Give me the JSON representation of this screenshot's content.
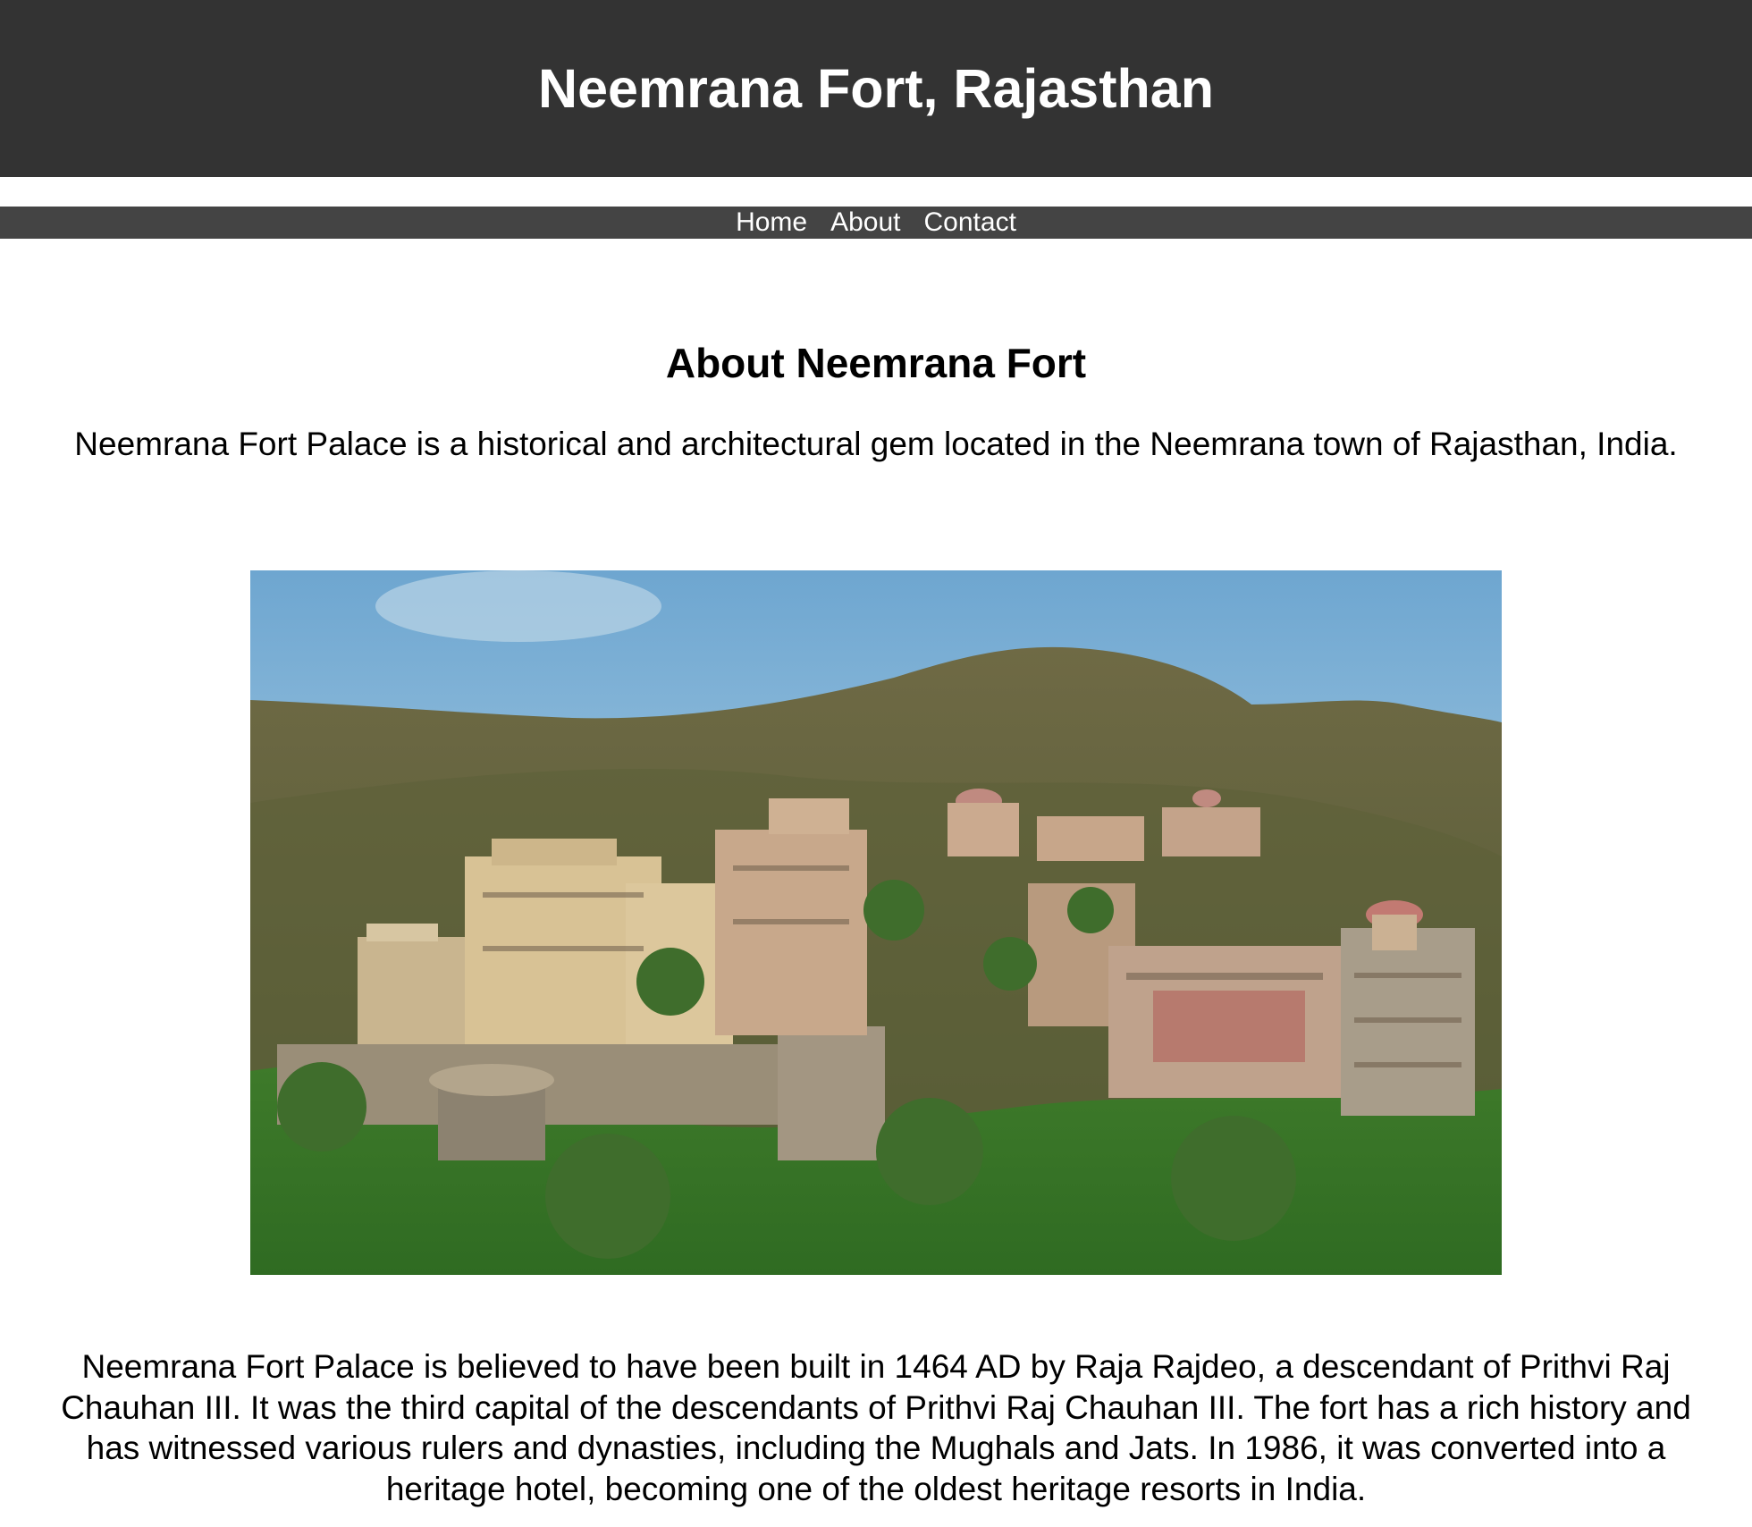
{
  "header": {
    "title": "Neemrana Fort, Rajasthan"
  },
  "nav": {
    "items": [
      {
        "label": "Home"
      },
      {
        "label": "About"
      },
      {
        "label": "Contact"
      }
    ]
  },
  "about": {
    "heading": "About Neemrana Fort",
    "intro": "Neemrana Fort Palace is a historical and architectural gem located in the Neemrana town of Rajasthan, India.",
    "history": "Neemrana Fort Palace is believed to have been built in 1464 AD by Raja Rajdeo, a descendant of Prithvi Raj Chauhan III. It was the third capital of the descendants of Prithvi Raj Chauhan III. The fort has a rich history and has witnessed various rulers and dynasties, including the Mughals and Jats. In 1986, it was converted into a heritage hotel, becoming one of the oldest heritage resorts in India."
  },
  "colors": {
    "header_bg": "#333333",
    "nav_bg": "#444444",
    "text_light": "#ffffff",
    "text_dark": "#000000"
  },
  "icons": {
    "photo": "fort-photo"
  }
}
